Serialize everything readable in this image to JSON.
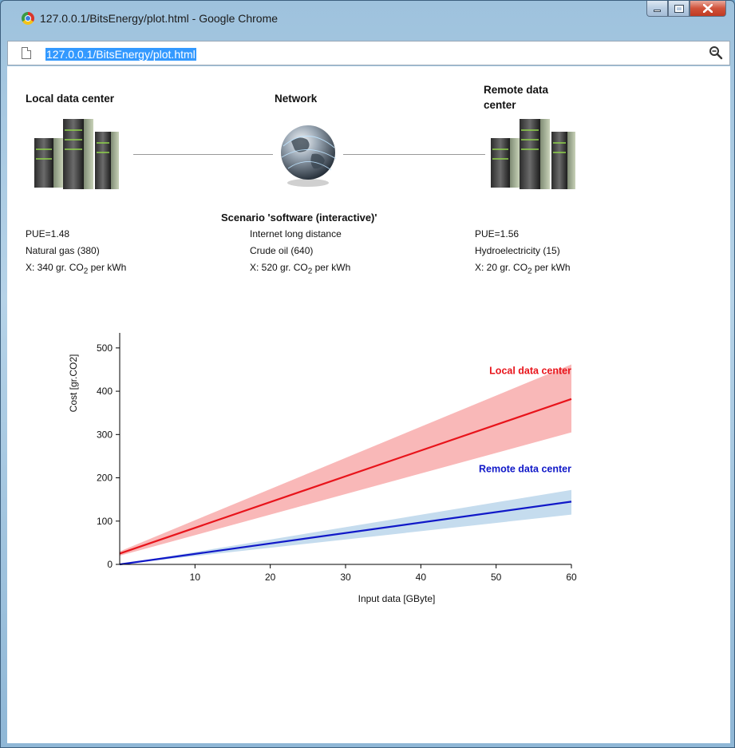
{
  "window": {
    "title": "127.0.0.1/BitsEnergy/plot.html - Google Chrome",
    "url": "127.0.0.1/BitsEnergy/plot.html"
  },
  "icons": [
    "chrome-icon",
    "page-icon",
    "zoom-icon",
    "server-icon",
    "globe-icon",
    "minimize-icon",
    "maximize-icon",
    "close-icon"
  ],
  "diagram": {
    "local": {
      "title": "Local data center",
      "pue": "PUE=1.48",
      "source": "Natural gas (380)",
      "x_prefix": "X: 340 gr. CO",
      "x_sub": "2",
      "x_suffix": " per kWh"
    },
    "network": {
      "title": "Network",
      "scenario": "Scenario 'software (interactive)'",
      "type": "Internet long distance",
      "source": "Crude oil (640)",
      "x_prefix": "X: 520 gr. CO",
      "x_sub": "2",
      "x_suffix": " per kWh"
    },
    "remote": {
      "title_line1": "Remote data",
      "title_line2": "center",
      "pue": "PUE=1.56",
      "source": "Hydroelectricity (15)",
      "x_prefix": "X: 20 gr. CO",
      "x_sub": "2",
      "x_suffix": " per kWh"
    }
  },
  "chart_data": {
    "type": "line",
    "xlabel": "Input data [GByte]",
    "ylabel": "Cost [gr.CO2]",
    "xlim": [
      0,
      60
    ],
    "ylim": [
      0,
      520
    ],
    "xticks": [
      10,
      20,
      30,
      40,
      50,
      60
    ],
    "yticks": [
      0,
      100,
      200,
      300,
      400,
      500
    ],
    "grid": false,
    "series": [
      {
        "name": "Local data center",
        "color": "#e8141b",
        "band_color": "#f9b8b8",
        "x": [
          0,
          60
        ],
        "y": [
          25,
          382
        ],
        "y_low": [
          20,
          305
        ],
        "y_high": [
          30,
          462
        ]
      },
      {
        "name": "Remote data center",
        "color": "#1018c8",
        "band_color": "#c5dcee",
        "x": [
          0,
          60
        ],
        "y": [
          0,
          145
        ],
        "y_low": [
          0,
          115
        ],
        "y_high": [
          0,
          172
        ]
      }
    ]
  }
}
